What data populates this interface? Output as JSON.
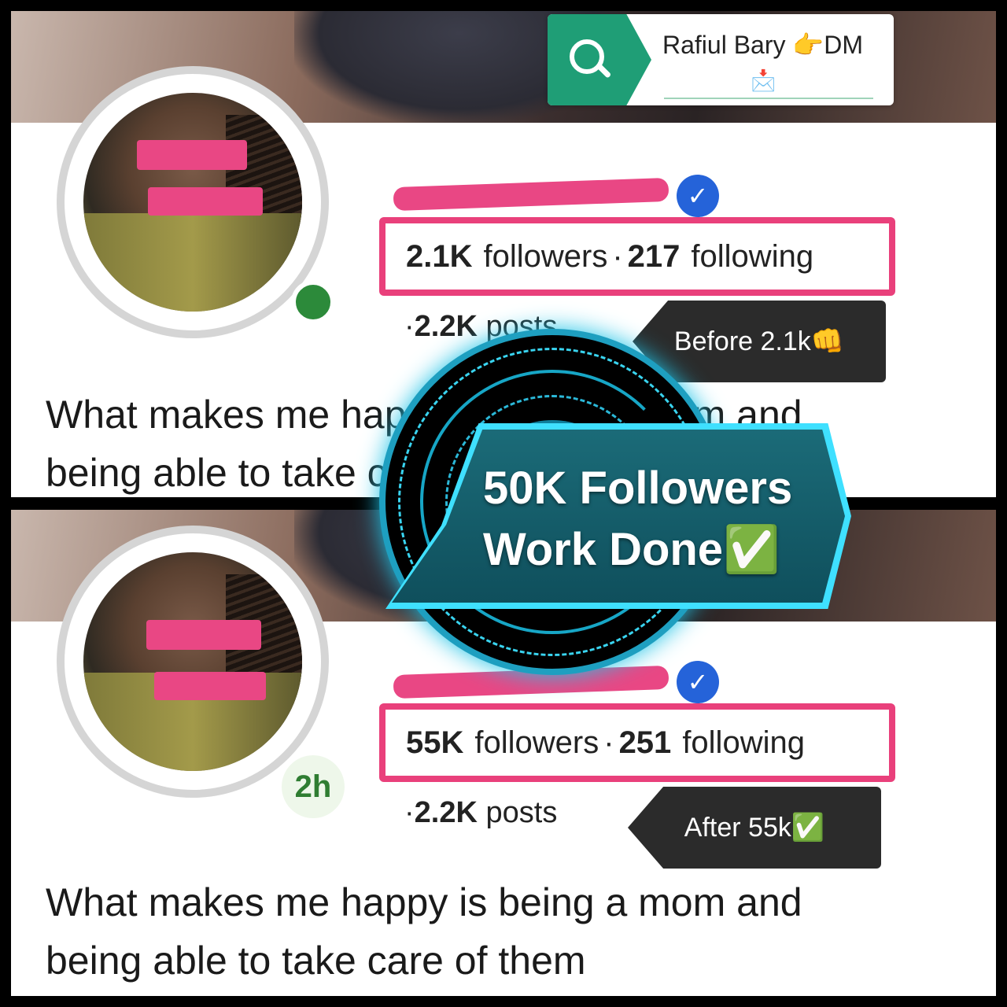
{
  "search": {
    "label": "Rafiul Bary 👉DM",
    "mail_emoji": "📩"
  },
  "before": {
    "followers_value": "2.1K",
    "followers_label": "followers",
    "separator": "·",
    "following_value": "217",
    "following_label": "following",
    "posts_prefix": "·",
    "posts_value": "2.2K",
    "posts_label": "posts",
    "callout": "Before 2.1k👊",
    "bio_line1": "What makes me happy is being a mom and",
    "bio_line2": "being able to take care of them"
  },
  "after": {
    "followers_value": "55K",
    "followers_label": "followers",
    "separator": "·",
    "following_value": "251",
    "following_label": "following",
    "posts_prefix": "·",
    "posts_value": "2.2K",
    "posts_label": "posts",
    "time_badge": "2h",
    "callout": "After 55k✅",
    "bio_line1": "What makes me happy is being a mom and",
    "bio_line2": "being able to take care of them"
  },
  "overlay": {
    "line1": "50K Followers",
    "line2": "Work Done✅"
  },
  "colors": {
    "highlight": "#e9407b",
    "verified": "#2563d9",
    "search_green": "#1f9e76",
    "glow": "#27d6f5"
  },
  "icons": {
    "search": "magnifier-icon",
    "verified": "verified-check-icon"
  }
}
